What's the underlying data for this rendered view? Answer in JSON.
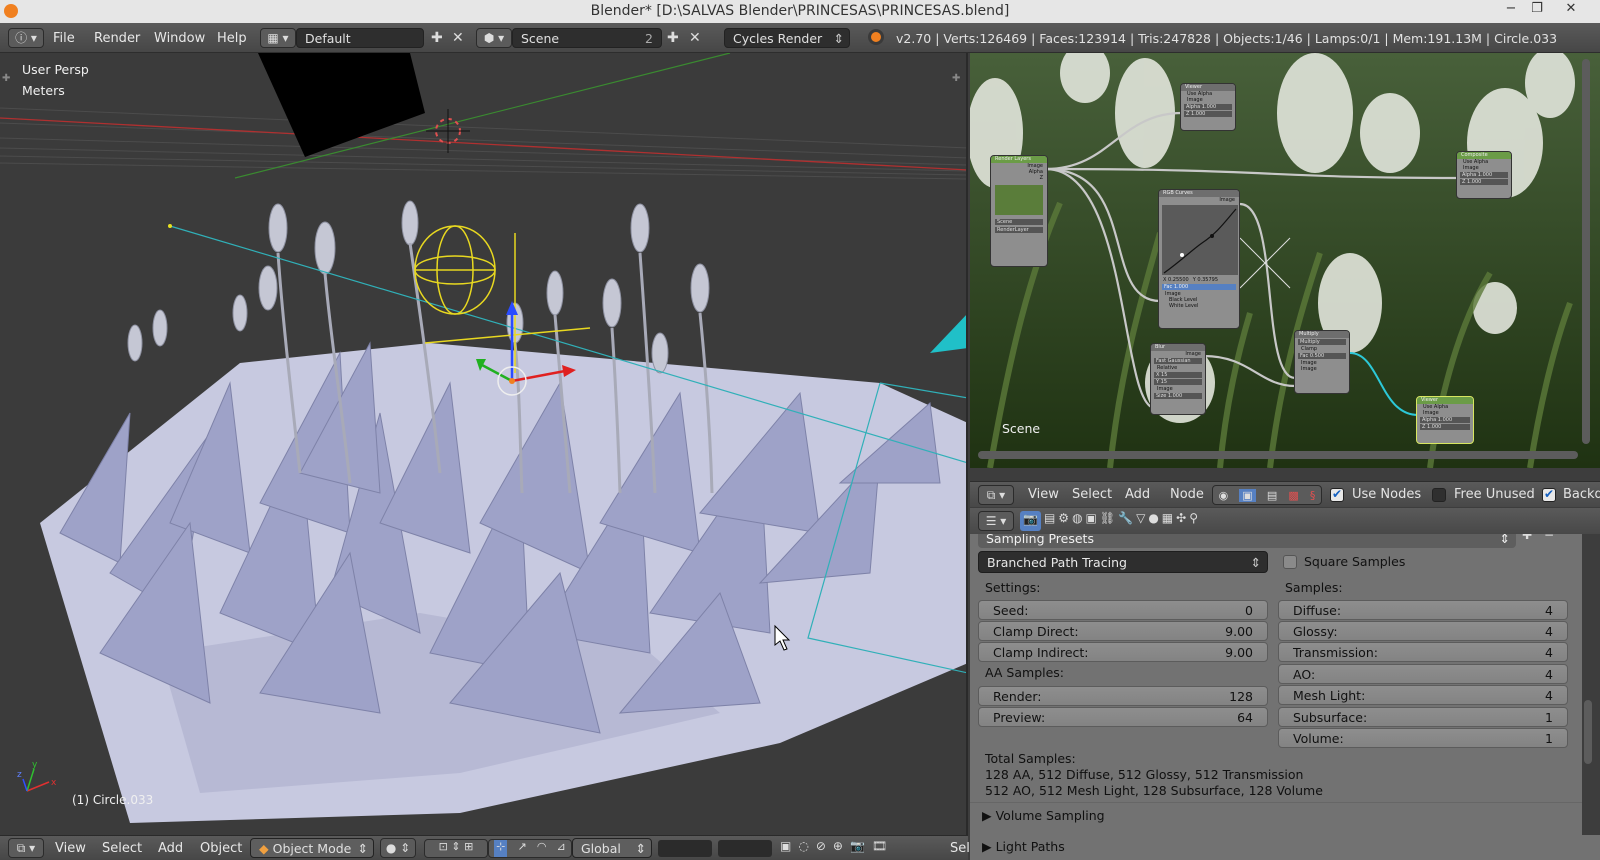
{
  "window": {
    "title": "Blender* [D:\\SALVAS Blender\\PRINCESAS\\PRINCESAS.blend]",
    "minimize": "−",
    "maximize": "❐",
    "close": "✕"
  },
  "info_header": {
    "menus": [
      "File",
      "Render",
      "Window",
      "Help"
    ],
    "screen_layout": "Default",
    "scene": "Scene",
    "scene_users": "2",
    "render_engine": "Cycles Render",
    "stats": "v2.70 | Verts:126469 | Faces:123914 | Tris:247828 | Objects:1/46 | Lamps:0/1 | Mem:191.13M | Circle.033"
  },
  "viewport": {
    "view_name": "User Persp",
    "units": "Meters",
    "object_label": "(1) Circle.033",
    "axis_labels": {
      "x": "x",
      "y": "y",
      "z": "z"
    }
  },
  "viewport_header": {
    "menus": [
      "View",
      "Select",
      "Add",
      "Object"
    ],
    "mode": "Object Mode",
    "orientation": "Global",
    "truncated_label": "Sel"
  },
  "node_editor": {
    "scene_label": "Scene",
    "nodes": [
      {
        "id": "render-layers",
        "title": "Render Layers",
        "lines": [
          "Image",
          "Alpha",
          "Z"
        ],
        "footer": [
          "Scene",
          "RenderLayer"
        ]
      },
      {
        "id": "viewer-top",
        "title": "Viewer",
        "lines": [
          "Use Alpha",
          "Image",
          "Alpha 1.000",
          "Z 1.000"
        ]
      },
      {
        "id": "rgb-curves",
        "title": "RGB Curves",
        "lines": [
          "Image",
          "X 0.25500",
          "Y 0.35795",
          "Fac 1.000",
          "Image",
          "Black Level",
          "White Level"
        ]
      },
      {
        "id": "blur",
        "title": "Blur",
        "lines": [
          "Image",
          "Fast Gaussian",
          "Relative",
          "X 15",
          "Y 15",
          "Image",
          "Size 1.000"
        ]
      },
      {
        "id": "multiply",
        "title": "Multiply",
        "lines": [
          "Multiply",
          "Clamp",
          "Fac 0.500",
          "Image",
          "Image"
        ]
      },
      {
        "id": "composite",
        "title": "Composite",
        "lines": [
          "Use Alpha",
          "Image",
          "Alpha 1.000",
          "Z 1.000"
        ]
      },
      {
        "id": "viewer-bottom",
        "title": "Viewer",
        "lines": [
          "Use Alpha",
          "Image",
          "Alpha 1.000",
          "Z 1.000"
        ]
      }
    ]
  },
  "node_header": {
    "menus": [
      "View",
      "Select",
      "Add",
      "Node"
    ],
    "use_nodes_label": "Use Nodes",
    "use_nodes": true,
    "free_unused_label": "Free Unused",
    "free_unused": false,
    "backdrop_label": "Backdro",
    "backdrop": true
  },
  "properties": {
    "sampling_presets": "Sampling Presets",
    "integrator": "Branched Path Tracing",
    "square_samples_label": "Square Samples",
    "settings_label": "Settings:",
    "samples_label": "Samples:",
    "seed": {
      "label": "Seed:",
      "value": "0"
    },
    "clamp_direct": {
      "label": "Clamp Direct:",
      "value": "9.00"
    },
    "clamp_indirect": {
      "label": "Clamp Indirect:",
      "value": "9.00"
    },
    "aa_samples_label": "AA Samples:",
    "render": {
      "label": "Render:",
      "value": "128"
    },
    "preview": {
      "label": "Preview:",
      "value": "64"
    },
    "diffuse": {
      "label": "Diffuse:",
      "value": "4"
    },
    "glossy": {
      "label": "Glossy:",
      "value": "4"
    },
    "transmission": {
      "label": "Transmission:",
      "value": "4"
    },
    "ao": {
      "label": "AO:",
      "value": "4"
    },
    "mesh_light": {
      "label": "Mesh Light:",
      "value": "4"
    },
    "subsurface": {
      "label": "Subsurface:",
      "value": "1"
    },
    "volume": {
      "label": "Volume:",
      "value": "1"
    },
    "total_samples_label": "Total Samples:",
    "total_line1": "128 AA, 512 Diffuse, 512 Glossy, 512 Transmission",
    "total_line2": "512 AO, 512 Mesh Light, 128 Subsurface, 128 Volume",
    "volume_sampling": "Volume Sampling",
    "light_paths": "Light Paths"
  },
  "colors": {
    "accent_blue": "#5680c2",
    "selection_orange": "#f08020",
    "camera_cyan": "#20c0c8"
  }
}
